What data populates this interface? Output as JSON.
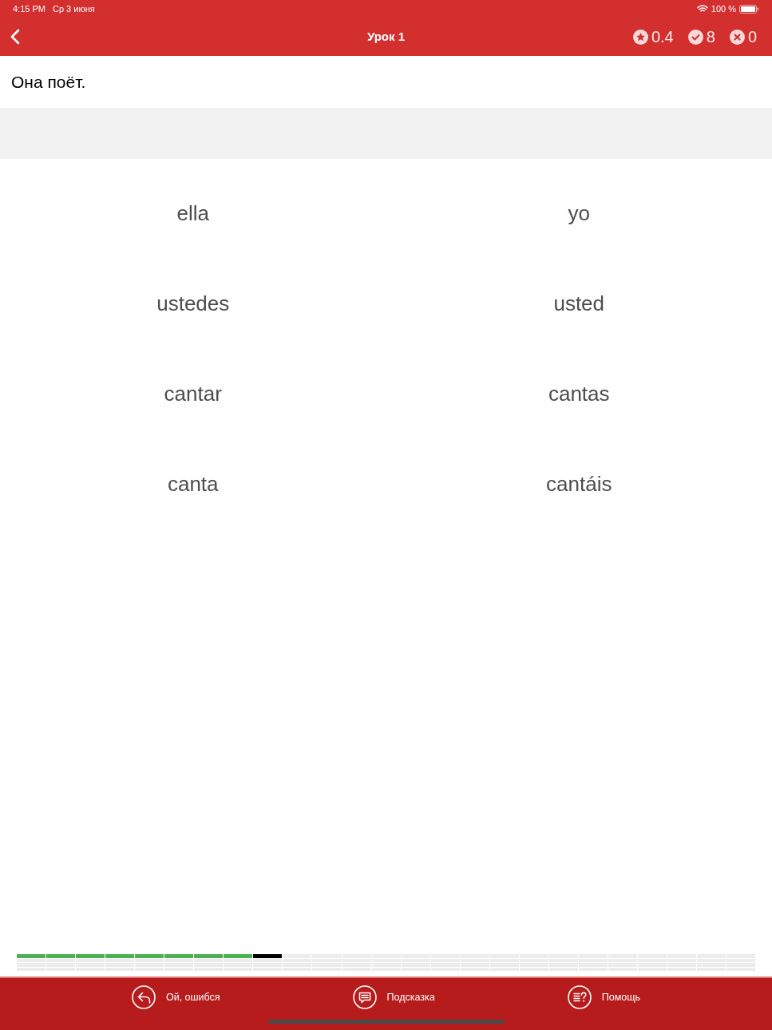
{
  "status_bar": {
    "time": "4:15 PM",
    "date": "Ср 3 июня",
    "battery": "100 %"
  },
  "nav_bar": {
    "title": "Урок 1",
    "stats": [
      {
        "kind": "stars",
        "value": "0.4"
      },
      {
        "kind": "correct",
        "value": "8"
      },
      {
        "kind": "wrong",
        "value": "0"
      }
    ]
  },
  "prompt": {
    "text": "Она поёт."
  },
  "options": [
    {
      "text": "ella"
    },
    {
      "text": "yo"
    },
    {
      "text": "ustedes"
    },
    {
      "text": "usted"
    },
    {
      "text": "cantar"
    },
    {
      "text": "cantas"
    },
    {
      "text": "canta"
    },
    {
      "text": "cantáis"
    }
  ],
  "progress": {
    "rows": [
      {
        "segments": [
          {
            "done": true,
            "current": false
          },
          {
            "done": true,
            "current": false
          },
          {
            "done": true,
            "current": false
          },
          {
            "done": true,
            "current": false
          },
          {
            "done": true,
            "current": false
          },
          {
            "done": true,
            "current": false
          },
          {
            "done": true,
            "current": false
          },
          {
            "done": true,
            "current": false
          },
          {
            "done": false,
            "current": true
          },
          {
            "done": false,
            "current": false
          },
          {
            "done": false,
            "current": false
          },
          {
            "done": false,
            "current": false
          },
          {
            "done": false,
            "current": false
          },
          {
            "done": false,
            "current": false
          },
          {
            "done": false,
            "current": false
          },
          {
            "done": false,
            "current": false
          },
          {
            "done": false,
            "current": false
          },
          {
            "done": false,
            "current": false
          },
          {
            "done": false,
            "current": false
          },
          {
            "done": false,
            "current": false
          },
          {
            "done": false,
            "current": false
          },
          {
            "done": false,
            "current": false
          },
          {
            "done": false,
            "current": false
          },
          {
            "done": false,
            "current": false
          },
          {
            "done": false,
            "current": false
          }
        ]
      },
      {
        "segments": [
          {
            "done": false,
            "current": false
          },
          {
            "done": false,
            "current": false
          },
          {
            "done": false,
            "current": false
          },
          {
            "done": false,
            "current": false
          },
          {
            "done": false,
            "current": false
          },
          {
            "done": false,
            "current": false
          },
          {
            "done": false,
            "current": false
          },
          {
            "done": false,
            "current": false
          },
          {
            "done": false,
            "current": false
          },
          {
            "done": false,
            "current": false
          },
          {
            "done": false,
            "current": false
          },
          {
            "done": false,
            "current": false
          },
          {
            "done": false,
            "current": false
          },
          {
            "done": false,
            "current": false
          },
          {
            "done": false,
            "current": false
          },
          {
            "done": false,
            "current": false
          },
          {
            "done": false,
            "current": false
          },
          {
            "done": false,
            "current": false
          },
          {
            "done": false,
            "current": false
          },
          {
            "done": false,
            "current": false
          },
          {
            "done": false,
            "current": false
          },
          {
            "done": false,
            "current": false
          },
          {
            "done": false,
            "current": false
          },
          {
            "done": false,
            "current": false
          },
          {
            "done": false,
            "current": false
          }
        ]
      },
      {
        "segments": [
          {
            "done": false,
            "current": false
          },
          {
            "done": false,
            "current": false
          },
          {
            "done": false,
            "current": false
          },
          {
            "done": false,
            "current": false
          },
          {
            "done": false,
            "current": false
          },
          {
            "done": false,
            "current": false
          },
          {
            "done": false,
            "current": false
          },
          {
            "done": false,
            "current": false
          },
          {
            "done": false,
            "current": false
          },
          {
            "done": false,
            "current": false
          },
          {
            "done": false,
            "current": false
          },
          {
            "done": false,
            "current": false
          },
          {
            "done": false,
            "current": false
          },
          {
            "done": false,
            "current": false
          },
          {
            "done": false,
            "current": false
          },
          {
            "done": false,
            "current": false
          },
          {
            "done": false,
            "current": false
          },
          {
            "done": false,
            "current": false
          },
          {
            "done": false,
            "current": false
          },
          {
            "done": false,
            "current": false
          },
          {
            "done": false,
            "current": false
          },
          {
            "done": false,
            "current": false
          },
          {
            "done": false,
            "current": false
          },
          {
            "done": false,
            "current": false
          },
          {
            "done": false,
            "current": false
          }
        ]
      },
      {
        "segments": [
          {
            "done": false,
            "current": false
          },
          {
            "done": false,
            "current": false
          },
          {
            "done": false,
            "current": false
          },
          {
            "done": false,
            "current": false
          },
          {
            "done": false,
            "current": false
          },
          {
            "done": false,
            "current": false
          },
          {
            "done": false,
            "current": false
          },
          {
            "done": false,
            "current": false
          },
          {
            "done": false,
            "current": false
          },
          {
            "done": false,
            "current": false
          },
          {
            "done": false,
            "current": false
          },
          {
            "done": false,
            "current": false
          },
          {
            "done": false,
            "current": false
          },
          {
            "done": false,
            "current": false
          },
          {
            "done": false,
            "current": false
          },
          {
            "done": false,
            "current": false
          },
          {
            "done": false,
            "current": false
          },
          {
            "done": false,
            "current": false
          },
          {
            "done": false,
            "current": false
          },
          {
            "done": false,
            "current": false
          },
          {
            "done": false,
            "current": false
          },
          {
            "done": false,
            "current": false
          },
          {
            "done": false,
            "current": false
          },
          {
            "done": false,
            "current": false
          },
          {
            "done": false,
            "current": false
          }
        ]
      }
    ]
  },
  "toolbar": [
    {
      "kind": "undo",
      "label": "Ой, ошибся"
    },
    {
      "kind": "hint",
      "label": "Подсказка"
    },
    {
      "kind": "help",
      "label": "Помощь"
    }
  ]
}
